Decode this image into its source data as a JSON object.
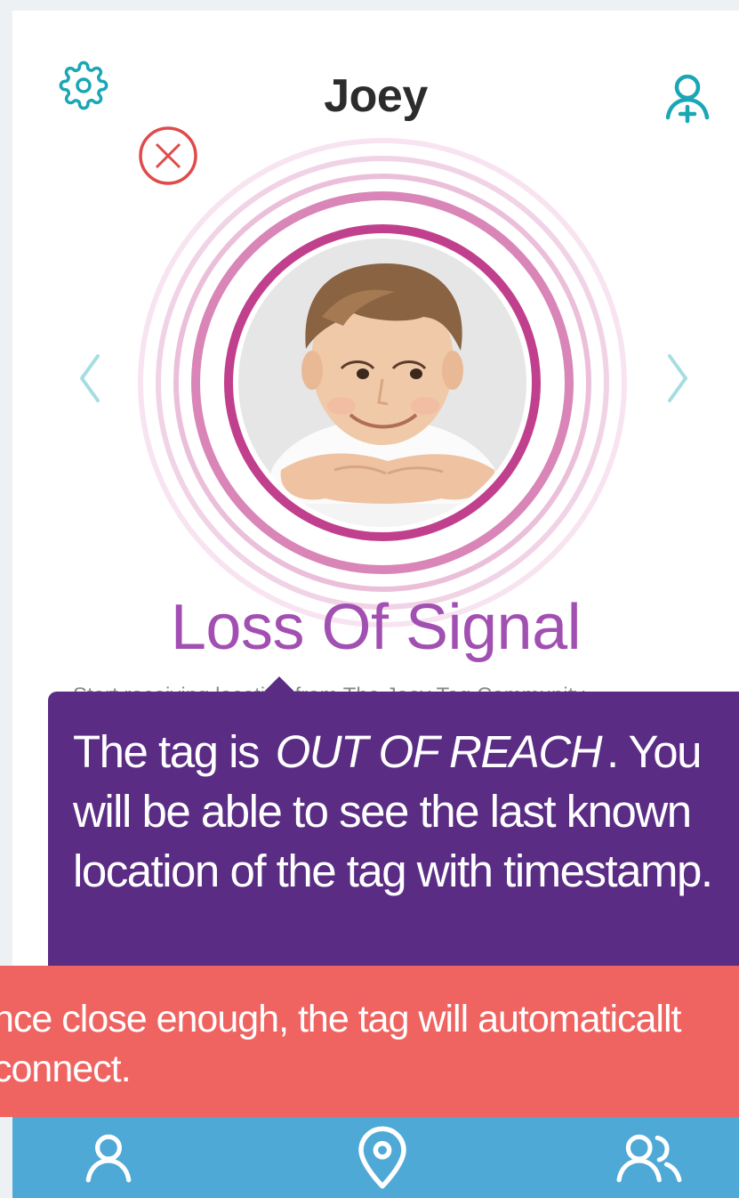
{
  "header": {
    "title": "Joey"
  },
  "profile": {
    "status": "Loss Of Signal",
    "subtitle": "Start receiving location from The Joey Tag Community"
  },
  "tooltip": {
    "prefix": "The tag is",
    "highlight": "OUT OF REACH",
    "suffix": ". You will be able to see the last known location of the tag with timestamp."
  },
  "banner": {
    "text": "nce close enough, the tag will automaticallt\nconnect."
  },
  "icons": {
    "settings": "gear-icon",
    "add_user": "add-user-icon",
    "close": "close-circle-icon",
    "prev": "chevron-left-icon",
    "next": "chevron-right-icon",
    "tab_profile": "user-icon",
    "tab_location": "location-pin-icon",
    "tab_community": "users-icon"
  },
  "colors": {
    "accent": "#1aa6b4",
    "ring": "#c1408e",
    "status": "#a24fb2",
    "tooltip": "#5a2c84",
    "banner": "#ef6461",
    "tabbar": "#4fa9d6",
    "close": "#e04a4a"
  }
}
